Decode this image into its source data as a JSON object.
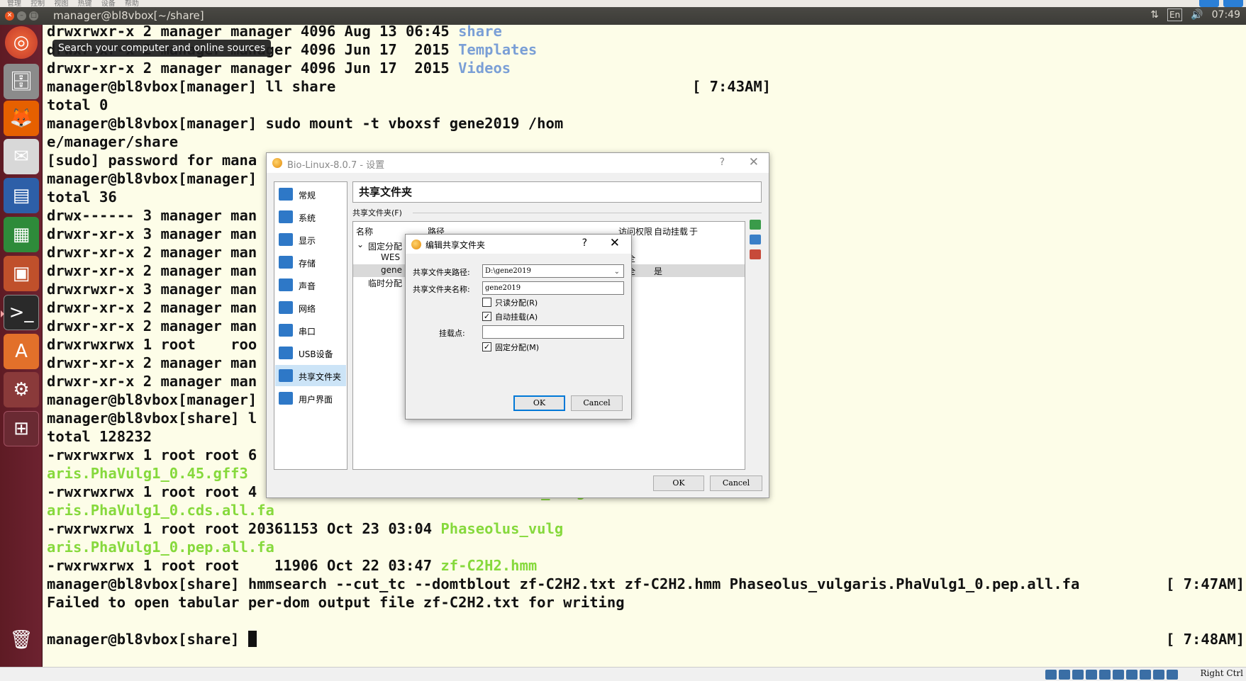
{
  "host_menu": [
    "管理",
    "控制",
    "视图",
    "热键",
    "设备",
    "帮助"
  ],
  "window": {
    "title": "manager@bl8vbox[~/share]"
  },
  "panel": {
    "lang_indicator": "En",
    "network_icon": "updown-arrows-icon",
    "volume_icon": "speaker-icon",
    "volume_glyph": "🔊",
    "clock": "07:49"
  },
  "launcher": {
    "tooltip": "Search your computer and online sources"
  },
  "terminal": {
    "lines": [
      {
        "pre": "drwxrwxr-x 2 manager manager 4096 Aug 13 06:45 ",
        "name": "share",
        "color": "blue"
      },
      {
        "pre": "drwxr-xr-x 2 manager manager 4096 Jun 17  2015 ",
        "name": "Templates",
        "color": "blue"
      },
      {
        "pre": "drwxr-xr-x 2 manager manager 4096 Jun 17  2015 ",
        "name": "Videos",
        "color": "blue"
      },
      {
        "text": "manager@bl8vbox[manager] ll share",
        "right": "[ 7:43AM]"
      },
      {
        "text": "total 0"
      },
      {
        "text": "manager@bl8vbox[manager] sudo mount -t vboxsf gene2019 /hom"
      },
      {
        "text": "e/manager/share"
      },
      {
        "text": "[sudo] password for mana"
      },
      {
        "text": "manager@bl8vbox[manager]"
      },
      {
        "text": "total 36"
      },
      {
        "text": "drwx------ 3 manager man"
      },
      {
        "text": "drwxr-xr-x 3 manager man"
      },
      {
        "text": "drwxr-xr-x 2 manager man"
      },
      {
        "text": "drwxr-xr-x 2 manager man"
      },
      {
        "text": "drwxrwxr-x 3 manager man"
      },
      {
        "text": "drwxr-xr-x 2 manager man"
      },
      {
        "text": "drwxr-xr-x 2 manager man"
      },
      {
        "text": "drwxrwxrwx 1 root    roo"
      },
      {
        "text": "drwxr-xr-x 2 manager man"
      },
      {
        "text": "drwxr-xr-x 2 manager man"
      },
      {
        "text": "manager@bl8vbox[manager]"
      },
      {
        "text": "manager@bl8vbox[share] l"
      },
      {
        "text": "total 128232"
      },
      {
        "text": "-rwxrwxrwx 1 root root 6"
      },
      {
        "green": "aris.PhaVulg1_0.45.gff3"
      },
      {
        "text": "-rwxrwxrwx 1 root root 4",
        "ghost_right": "Phaseolus_vulg"
      },
      {
        "green": "aris.PhaVulg1_0.cds.all.fa"
      },
      {
        "pre": "-rwxrwxrwx 1 root root 20361153 Oct 23 03:04 ",
        "name": "Phaseolus_vulg",
        "color": "green"
      },
      {
        "green": "aris.PhaVulg1_0.pep.all.fa"
      },
      {
        "pre": "-rwxrwxrwx 1 root root    11906 Oct 22 03:47 ",
        "name": "zf-C2H2.hmm",
        "color": "green"
      },
      {
        "text": "manager@bl8vbox[share] hmmsearch --cut_tc --domtblout zf-C2H2.txt zf-C2H2.hmm Phaseolus_vulgaris.PhaVulg1_0.pep.all.fa",
        "right": "[ 7:47AM]"
      },
      {
        "text": "Failed to open tabular per-dom output file zf-C2H2.txt for writing"
      },
      {
        "text": ""
      },
      {
        "text": "manager@bl8vbox[share] ",
        "cursor": true,
        "right": "[ 7:48AM]"
      }
    ]
  },
  "settings_dialog": {
    "title": "Bio-Linux-8.0.7 - 设置",
    "help": "?",
    "close": "✕",
    "nav": [
      {
        "label": "常规",
        "icon": "monitor-icon"
      },
      {
        "label": "系统",
        "icon": "chip-icon"
      },
      {
        "label": "显示",
        "icon": "display-icon"
      },
      {
        "label": "存储",
        "icon": "disk-icon"
      },
      {
        "label": "声音",
        "icon": "speaker-icon"
      },
      {
        "label": "网络",
        "icon": "network-icon"
      },
      {
        "label": "串口",
        "icon": "serial-port-icon"
      },
      {
        "label": "USB设备",
        "icon": "usb-icon"
      },
      {
        "label": "共享文件夹",
        "icon": "folder-icon",
        "active": true
      },
      {
        "label": "用户界面",
        "icon": "window-icon"
      }
    ],
    "page_title": "共享文件夹",
    "group_label": "共享文件夹(F)",
    "columns": [
      "名称",
      "路径",
      "访问权限",
      "自动挂载",
      "于"
    ],
    "tree": {
      "group_fixed": "固定分配",
      "rows": [
        {
          "name": "WES",
          "access": "完全",
          "auto": ""
        },
        {
          "name": "gene",
          "access": "完全",
          "auto": "是"
        }
      ],
      "group_temp": "临时分配"
    },
    "ok": "OK",
    "cancel": "Cancel"
  },
  "edit_dialog": {
    "title": "编辑共享文件夹",
    "help": "?",
    "close": "✕",
    "path_label": "共享文件夹路径:",
    "path_value": "D:\\gene2019",
    "name_label": "共享文件夹名称:",
    "name_value": "gene2019",
    "readonly_label": "只读分配(R)",
    "readonly_checked": false,
    "automount_label": "自动挂载(A)",
    "automount_checked": true,
    "mountpoint_label": "挂载点:",
    "mountpoint_value": "",
    "permanent_label": "固定分配(M)",
    "permanent_checked": true,
    "ok": "OK",
    "cancel": "Cancel"
  },
  "status_bar": {
    "host_key": "Right Ctrl"
  },
  "colors": {
    "terminal_bg": "#fdfde8",
    "dir_blue": "#7a9fd6",
    "exec_green": "#86d93c",
    "launcher": "#6d2230",
    "accent": "#0078d7"
  }
}
